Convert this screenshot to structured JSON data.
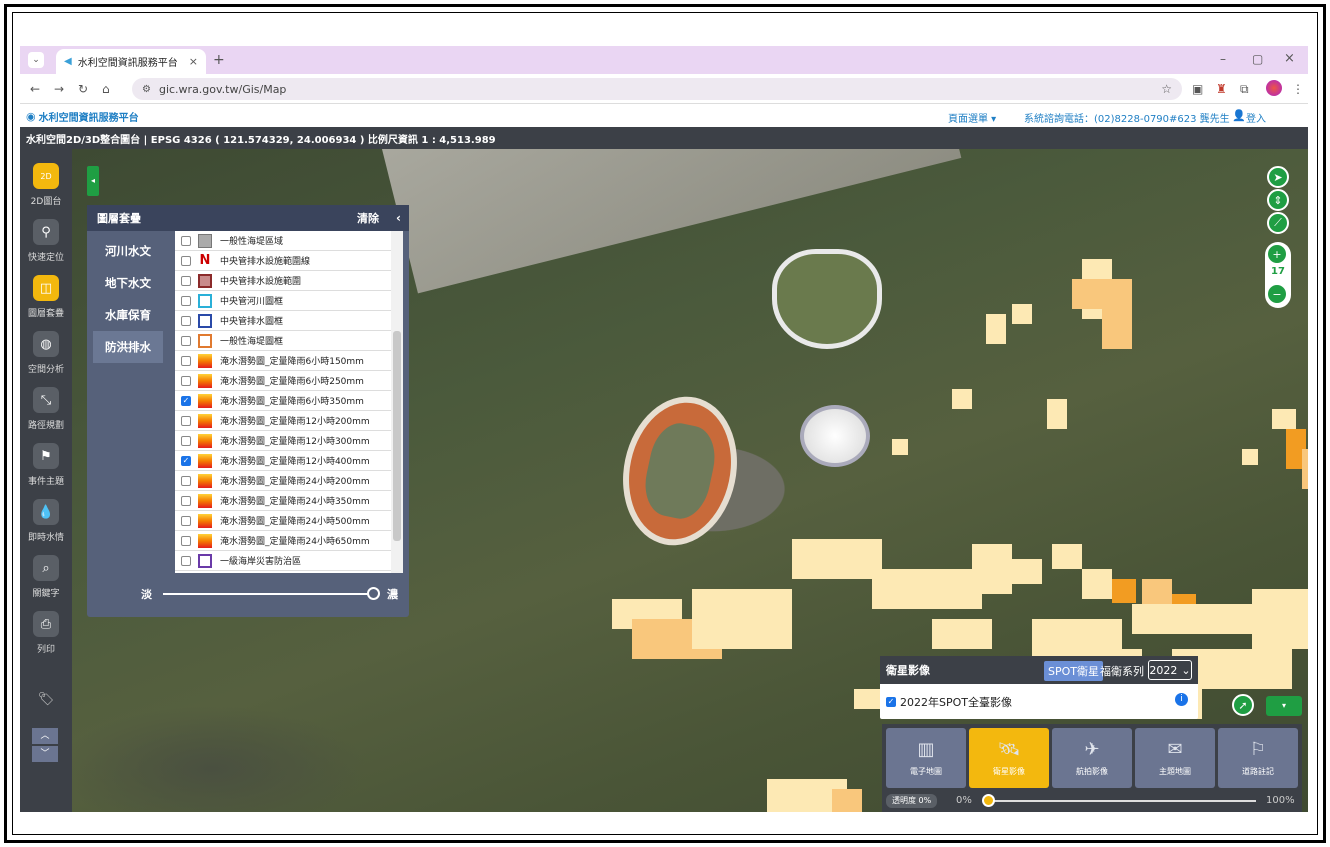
{
  "browser": {
    "tab_title": "水利空間資訊服務平台",
    "url": "gic.wra.gov.tw/Gis/Map"
  },
  "site": {
    "name": "水利空間資訊服務平台",
    "page_menu": "頁面選單 ▾",
    "hotline": "系統諮詢電話：(02)8228-0790#623 龔先生",
    "login": "登入"
  },
  "infobar": {
    "text": "水利空間2D/3D整合圖台 | EPSG 4326 ( 121.574329, 24.006934 ) 比例尺資訊 1 : 4,513.989"
  },
  "sidebar": {
    "items": [
      {
        "label": "2D圖台",
        "icon": "2d-icon"
      },
      {
        "label": "快速定位",
        "icon": "location-pin-icon"
      },
      {
        "label": "圖層套疊",
        "icon": "layers-icon"
      },
      {
        "label": "空間分析",
        "icon": "globe-icon"
      },
      {
        "label": "路徑規劃",
        "icon": "route-icon"
      },
      {
        "label": "事件主題",
        "icon": "flag-icon"
      },
      {
        "label": "即時水情",
        "icon": "water-drop-icon"
      },
      {
        "label": "關鍵字",
        "icon": "search-icon"
      },
      {
        "label": "列印",
        "icon": "printer-icon"
      }
    ]
  },
  "layer_panel": {
    "title": "圖層套疊",
    "clear": "清除",
    "tabs": [
      "河川水文",
      "地下水文",
      "水庫保育",
      "防洪排水"
    ],
    "layers": [
      {
        "label": "一般性海堤區域",
        "checked": false,
        "sym": "gray-box"
      },
      {
        "label": "中央管排水設施範圍線",
        "checked": false,
        "sym": "red-line"
      },
      {
        "label": "中央管排水設施範圍",
        "checked": false,
        "sym": "red-box"
      },
      {
        "label": "中央管河川圖框",
        "checked": false,
        "sym": "cyan-box"
      },
      {
        "label": "中央管排水圖框",
        "checked": false,
        "sym": "blue-box"
      },
      {
        "label": "一般性海堤圖框",
        "checked": false,
        "sym": "orange-box"
      },
      {
        "label": "淹水潛勢圖_定量降雨6小時150mm",
        "checked": false,
        "sym": "gradient"
      },
      {
        "label": "淹水潛勢圖_定量降雨6小時250mm",
        "checked": false,
        "sym": "gradient"
      },
      {
        "label": "淹水潛勢圖_定量降雨6小時350mm",
        "checked": true,
        "sym": "gradient"
      },
      {
        "label": "淹水潛勢圖_定量降雨12小時200mm",
        "checked": false,
        "sym": "gradient"
      },
      {
        "label": "淹水潛勢圖_定量降雨12小時300mm",
        "checked": false,
        "sym": "gradient"
      },
      {
        "label": "淹水潛勢圖_定量降雨12小時400mm",
        "checked": true,
        "sym": "gradient"
      },
      {
        "label": "淹水潛勢圖_定量降雨24小時200mm",
        "checked": false,
        "sym": "gradient"
      },
      {
        "label": "淹水潛勢圖_定量降雨24小時350mm",
        "checked": false,
        "sym": "gradient"
      },
      {
        "label": "淹水潛勢圖_定量降雨24小時500mm",
        "checked": false,
        "sym": "gradient"
      },
      {
        "label": "淹水潛勢圖_定量降雨24小時650mm",
        "checked": false,
        "sym": "gradient"
      },
      {
        "label": "一級海岸災害防治區",
        "checked": false,
        "sym": "purple-box"
      }
    ],
    "opacity_light": "淡",
    "opacity_dark": "濃"
  },
  "zoom": {
    "level": "17"
  },
  "imagery": {
    "title": "衛星影像",
    "spot": "SPOT衛星",
    "series": "福衛系列",
    "year": "2022",
    "layer": "2022年SPOT全臺影像"
  },
  "basemaps": [
    {
      "label": "電子地圖",
      "icon": "map-icon"
    },
    {
      "label": "衛星影像",
      "icon": "satellite-icon"
    },
    {
      "label": "航拍影像",
      "icon": "airplane-icon"
    },
    {
      "label": "主題地圖",
      "icon": "paper-plane-icon"
    },
    {
      "label": "道路註記",
      "icon": "road-pin-icon"
    }
  ],
  "transparency": {
    "label": "透明度 0%",
    "min": "0%",
    "max": "100%",
    "value": 0
  }
}
